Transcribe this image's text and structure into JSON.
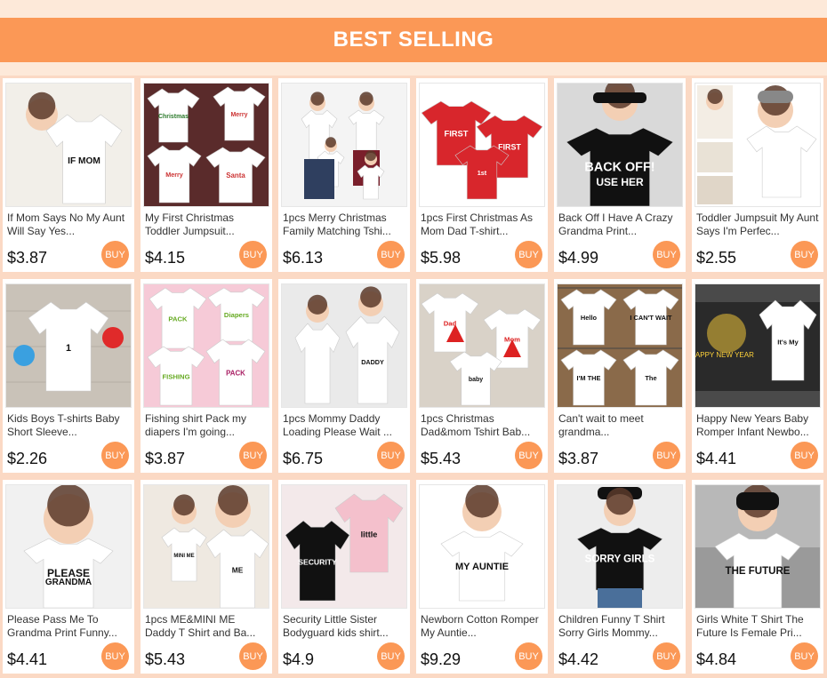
{
  "banner": {
    "title": "BEST SELLING"
  },
  "colors": {
    "accent": "#fb9856",
    "background": "#fde9d9",
    "grid": "#fbd9c4"
  },
  "buy_label": "BUY",
  "products": [
    {
      "title": "If Mom Says No My Aunt Will Say Yes...",
      "price": "$3.87",
      "image": "white-onesie"
    },
    {
      "title": "My First Christmas Toddler Jumpsuit...",
      "price": "$4.15",
      "image": "christmas-onesies"
    },
    {
      "title": "1pcs Merry Christmas Family Matching Tshi...",
      "price": "$6.13",
      "image": "family-photo"
    },
    {
      "title": "1pcs First Christmas As Mom Dad T-shirt...",
      "price": "$5.98",
      "image": "red-tshirts"
    },
    {
      "title": "Back Off I Have A Crazy Grandma Print...",
      "price": "$4.99",
      "image": "black-tshirt-girl"
    },
    {
      "title": "Toddler Jumpsuit My Aunt Says I'm Perfec...",
      "price": "$2.55",
      "image": "baby-collage"
    },
    {
      "title": "Kids Boys T-shirts Baby Short Sleeve...",
      "price": "$2.26",
      "image": "birthday-shirt"
    },
    {
      "title": "Fishing shirt Pack my diapers I'm going...",
      "price": "$3.87",
      "image": "pink-onesies"
    },
    {
      "title": "1pcs Mommy Daddy Loading Please Wait ...",
      "price": "$6.75",
      "image": "couple-photo"
    },
    {
      "title": "1pcs Christmas Dad&mom Tshirt Bab...",
      "price": "$5.43",
      "image": "christmas-tree-shirts"
    },
    {
      "title": "Can't wait to meet grandma...",
      "price": "$3.87",
      "image": "clothesline-onesies"
    },
    {
      "title": "Happy New Years Baby Romper Infant Newbo...",
      "price": "$4.41",
      "image": "new-year-romper"
    },
    {
      "title": "Please Pass Me To Grandma Print Funny...",
      "price": "$4.41",
      "image": "baby-grandma"
    },
    {
      "title": "1pcs ME&MINI ME Daddy T Shirt and Ba...",
      "price": "$5.43",
      "image": "dad-baby"
    },
    {
      "title": "Security Little Sister Bodyguard kids shirt...",
      "price": "$4.9",
      "image": "security-sister"
    },
    {
      "title": "Newborn Cotton Romper My Auntie...",
      "price": "$9.29",
      "image": "newborn-romper"
    },
    {
      "title": "Children Funny T Shirt Sorry Girls Mommy...",
      "price": "$4.42",
      "image": "boy-black-tshirt"
    },
    {
      "title": "Girls White T Shirt The Future Is Female Pri...",
      "price": "$4.84",
      "image": "girl-future-female"
    }
  ]
}
